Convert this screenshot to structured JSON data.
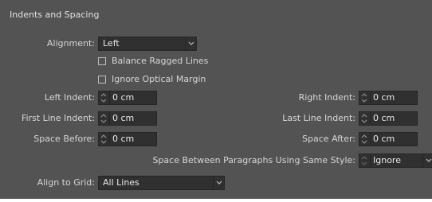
{
  "panel": {
    "title": "Indents and Spacing"
  },
  "alignment": {
    "label": "Alignment:",
    "value": "Left"
  },
  "checkboxes": {
    "balance_ragged": {
      "label": "Balance Ragged Lines",
      "checked": false
    },
    "ignore_optical": {
      "label": "Ignore Optical Margin",
      "checked": false
    }
  },
  "left_indent": {
    "label": "Left Indent:",
    "value": "0 cm"
  },
  "right_indent": {
    "label": "Right Indent:",
    "value": "0 cm"
  },
  "first_line_indent": {
    "label": "First Line Indent:",
    "value": "0 cm"
  },
  "last_line_indent": {
    "label": "Last Line Indent:",
    "value": "0 cm"
  },
  "space_before": {
    "label": "Space Before:",
    "value": "0 cm"
  },
  "space_after": {
    "label": "Space After:",
    "value": "0 cm"
  },
  "space_between": {
    "label": "Space Between Paragraphs Using Same Style:",
    "value": "Ignore"
  },
  "align_to_grid": {
    "label": "Align to Grid:",
    "value": "All Lines"
  },
  "colors": {
    "panel_bg": "#535353",
    "field_bg": "#303030",
    "text": "#d6d6d6"
  },
  "icons": {
    "dropdown": "chevron-down-icon",
    "spinner": "spinner-arrows-icon"
  }
}
